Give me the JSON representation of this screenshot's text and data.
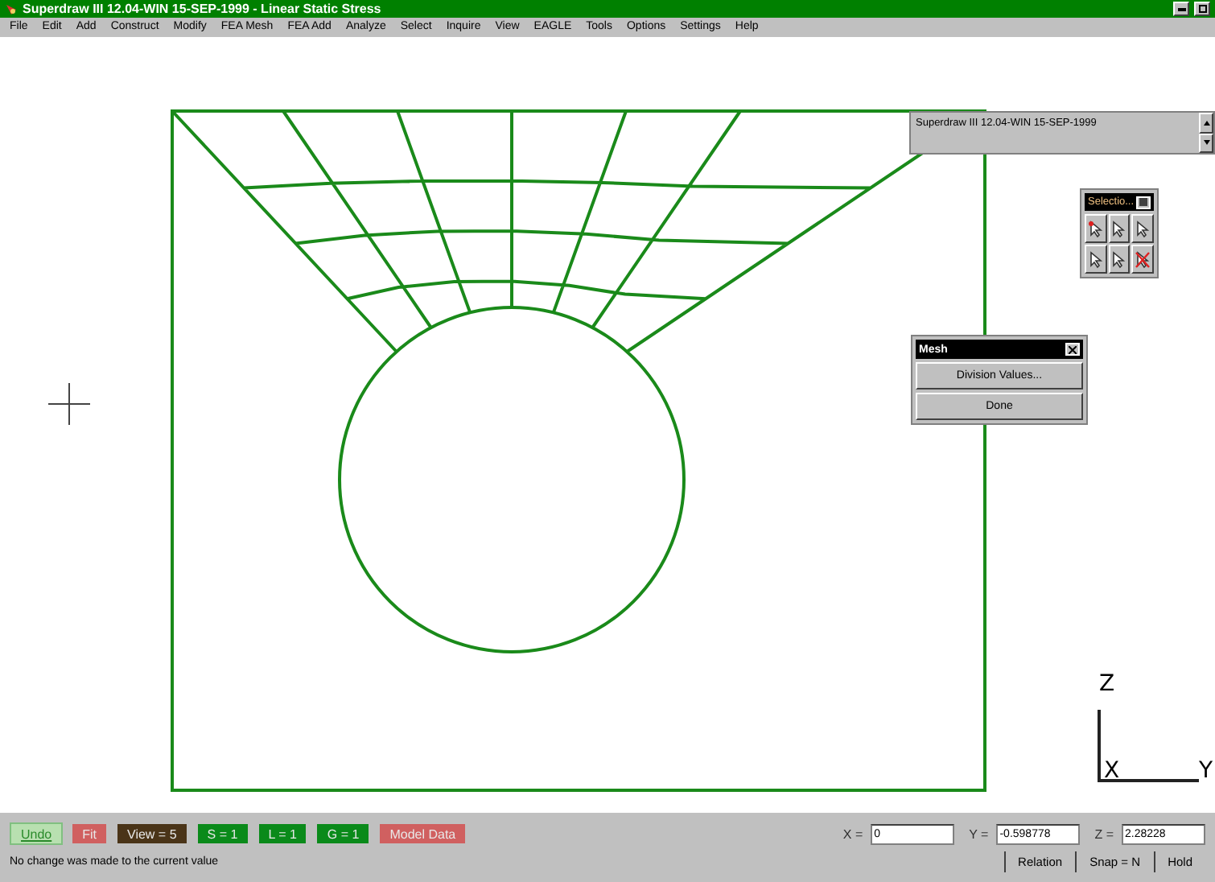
{
  "window": {
    "title": "Superdraw III 12.04-WIN 15-SEP-1999 - Linear Static Stress"
  },
  "menu": [
    "File",
    "Edit",
    "Add",
    "Construct",
    "Modify",
    "FEA Mesh",
    "FEA Add",
    "Analyze",
    "Select",
    "Inquire",
    "View",
    "EAGLE",
    "Tools",
    "Options",
    "Settings",
    "Help"
  ],
  "info_box": {
    "text": "Superdraw III 12.04-WIN 15-SEP-1999"
  },
  "selection_palette": {
    "title": "Selectio..."
  },
  "mesh_dialog": {
    "title": "Mesh",
    "buttons": [
      "Division Values...",
      "Done"
    ]
  },
  "axis": {
    "z": "Z",
    "x": "X",
    "y": "Y"
  },
  "status_buttons": [
    {
      "label": "Undo",
      "kind": "link",
      "color": "#b8e0b0"
    },
    {
      "label": "Fit",
      "kind": "tag",
      "color": "#d06060"
    },
    {
      "label": "View = 5",
      "kind": "tag",
      "color": "#4a3418"
    },
    {
      "label": "S = 1",
      "kind": "tag",
      "color": "#0a8a1a"
    },
    {
      "label": "L = 1",
      "kind": "tag",
      "color": "#0a8a1a"
    },
    {
      "label": "G = 1",
      "kind": "tag",
      "color": "#0a8a1a"
    },
    {
      "label": "Model Data",
      "kind": "tag",
      "color": "#d06060"
    }
  ],
  "coordinates": [
    {
      "label": "X =",
      "value": "0"
    },
    {
      "label": "Y =",
      "value": "-0.598778"
    },
    {
      "label": "Z =",
      "value": "2.28228"
    }
  ],
  "message": "No change was made to the current value",
  "bottom_buttons": [
    "Relation",
    "Snap = N",
    "Hold"
  ]
}
